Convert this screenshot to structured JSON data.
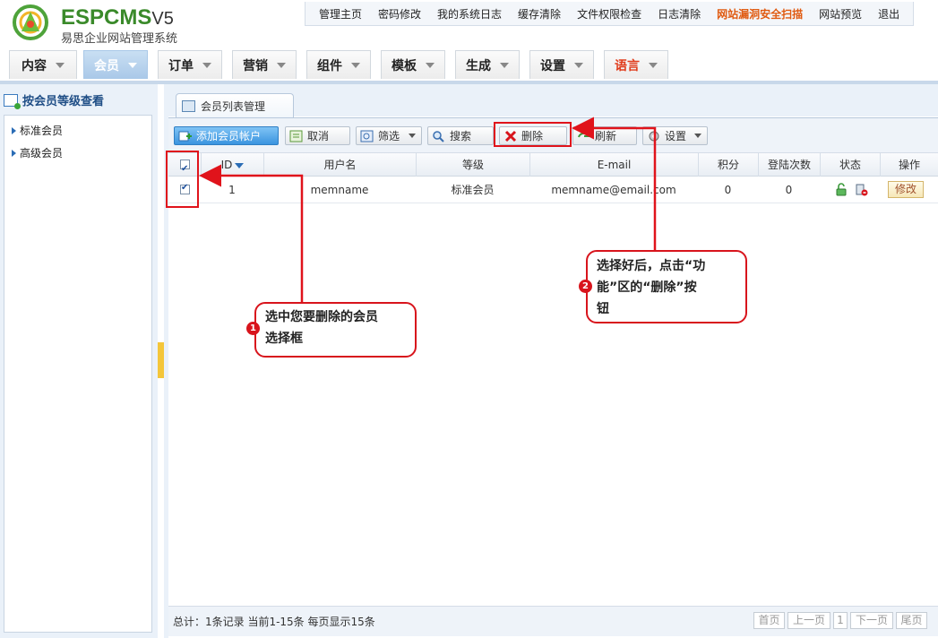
{
  "logo": {
    "name_esp": "ESP",
    "name_cms": "CMS",
    "version": "V5",
    "subtitle": "易思企业网站管理系统"
  },
  "topnav": [
    "管理主页",
    "密码修改",
    "我的系统日志",
    "缓存清除",
    "文件权限检查",
    "日志清除",
    "网站漏洞安全扫描",
    "网站预览",
    "退出"
  ],
  "tabs": [
    "内容",
    "会员",
    "订单",
    "营销",
    "组件",
    "模板",
    "生成",
    "设置",
    "语言"
  ],
  "sidebar": {
    "title": "按会员等级查看",
    "items": [
      "标准会员",
      "高级会员"
    ]
  },
  "panel_tab": "会员列表管理",
  "toolbar": {
    "add": "添加会员帐户",
    "cancel": "取消",
    "filter": "筛选",
    "search": "搜索",
    "delete": "删除",
    "refresh": "刷新",
    "settings": "设置"
  },
  "table": {
    "headers": [
      "ID",
      "用户名",
      "等级",
      "E-mail",
      "积分",
      "登陆次数",
      "状态",
      "操作"
    ],
    "rows": [
      {
        "id": "1",
        "username": "memname",
        "level": "标准会员",
        "email": "memname@email.com",
        "points": "0",
        "logins": "0",
        "action": "修改"
      }
    ]
  },
  "footer": {
    "summary": "总计：1条记录 当前1-15条 每页显示15条",
    "pager": [
      "首页",
      "上一页",
      "1",
      "下一页",
      "尾页"
    ]
  },
  "annotations": {
    "step1": {
      "num": "1",
      "line1": "选中您要删除的会员",
      "line2": "选择框"
    },
    "step2": {
      "num": "2",
      "line1": "选择好后，点击“功",
      "line2": "能”区的“删除”按",
      "line3": "钮"
    }
  }
}
